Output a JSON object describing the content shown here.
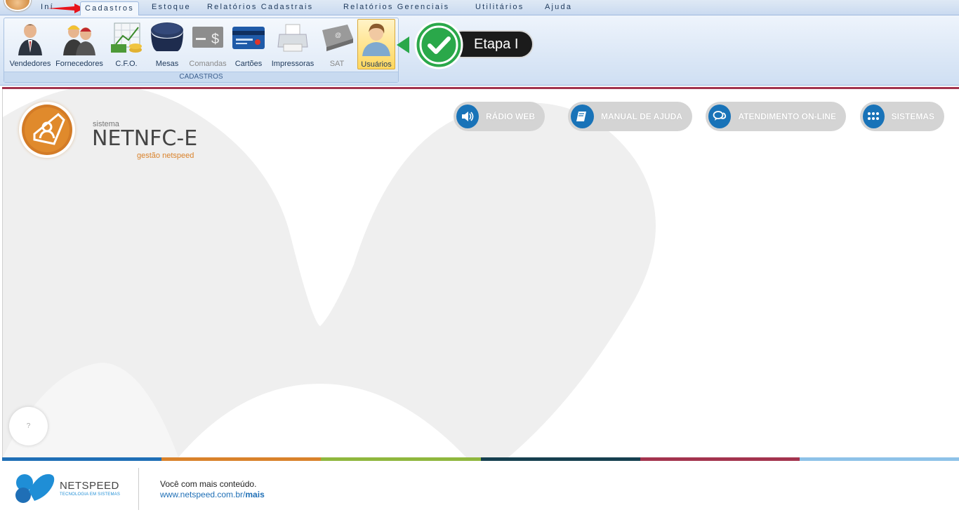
{
  "menu": {
    "partial_first_tab": "Iní",
    "tabs": [
      {
        "label": "Cadastros",
        "active": true
      },
      {
        "label": "Estoque",
        "active": false
      },
      {
        "label": "Relatórios Cadastrais",
        "active": false
      },
      {
        "label": "Relatórios Gerenciais",
        "active": false
      },
      {
        "label": "Utilitários",
        "active": false
      },
      {
        "label": "Ajuda",
        "active": false
      }
    ]
  },
  "ribbon": {
    "group_label": "CADASTROS",
    "buttons": [
      {
        "label": "Vendedores",
        "icon": "salesman-icon"
      },
      {
        "label": "Fornecedores",
        "icon": "suppliers-icon"
      },
      {
        "label": "C.F.O.",
        "icon": "cfo-chart-icon"
      },
      {
        "label": "Mesas",
        "icon": "table-icon"
      },
      {
        "label": "Comandas",
        "icon": "order-slip-icon",
        "disabled": true
      },
      {
        "label": "Cartões",
        "icon": "credit-card-icon"
      },
      {
        "label": "Impressoras",
        "icon": "printer-icon"
      },
      {
        "label": "SAT",
        "icon": "sat-device-icon",
        "disabled": true
      },
      {
        "label": "Usuários",
        "icon": "user-icon",
        "selected": true
      }
    ]
  },
  "callout": {
    "label": "Etapa I",
    "color": "#2aa84a"
  },
  "brand": {
    "sub_top": "sistema",
    "title": "NETNFC-E",
    "sub_bottom": "gestão netspeed",
    "accent": "#d9822b"
  },
  "quick_links": [
    {
      "label": "RÁDIO WEB",
      "icon": "speaker-icon"
    },
    {
      "label": "MANUAL DE AJUDA",
      "icon": "book-icon"
    },
    {
      "label": "ATENDIMENTO ON-LINE",
      "icon": "chat-icon"
    },
    {
      "label": "SISTEMAS",
      "icon": "grid-icon"
    }
  ],
  "help_button": {
    "label": "?"
  },
  "footer": {
    "company": "NETSPEED",
    "tagline": "TECNOLOGIA EM SISTEMAS",
    "text": "Você com mais conteúdo.",
    "link_prefix": "www.netspeed.com.br/",
    "link_bold": "mais",
    "colors": [
      "#1f6fb6",
      "#d9822b",
      "#8fb73e",
      "#16404f",
      "#a3344e",
      "#8ec2e8"
    ]
  }
}
